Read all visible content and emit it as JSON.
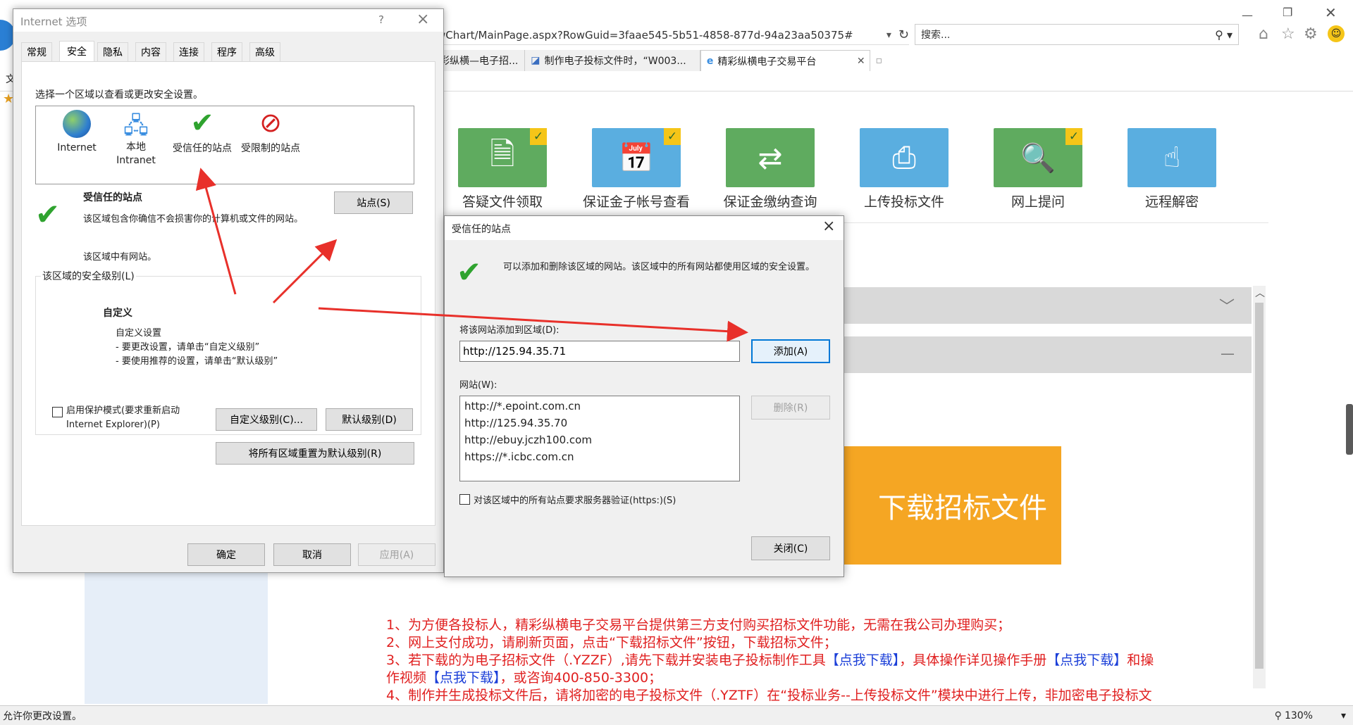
{
  "browser": {
    "address": "wChart/MainPage.aspx?RowGuid=3faae545-5b51-4858-877d-94a23aa50375#",
    "search_placeholder": "搜索...",
    "tabs": [
      {
        "label": "彩纵横—电子招..."
      },
      {
        "label": "制作电子投标文件时，“W003..."
      },
      {
        "label": "精彩纵横电子交易平台"
      }
    ],
    "zoom": "130%",
    "status": "允许你更改设置。",
    "left_edge": "文"
  },
  "page": {
    "tiles": [
      {
        "label": "答疑文件领取",
        "color": "#5fab5f",
        "checked": true
      },
      {
        "label": "保证金子帐号查看",
        "color": "#5aaee0",
        "checked": true
      },
      {
        "label": "保证金缴纳查询",
        "color": "#5fab5f",
        "checked": false
      },
      {
        "label": "上传投标文件",
        "color": "#5aaee0",
        "checked": false
      },
      {
        "label": "网上提问",
        "color": "#5fab5f",
        "checked": true
      },
      {
        "label": "远程解密",
        "color": "#5aaee0",
        "checked": false
      }
    ],
    "download_button": "下载招标文件",
    "notices": {
      "l1": "1、为方便各投标人，精彩纵横电子交易平台提供第三方支付购买招标文件功能，无需在我公司办理购买；",
      "l2": "2、网上支付成功，请刷新页面，点击“下载招标文件”按钮，下载招标文件；",
      "l3a": "3、若下载的为电子招标文件（.YZZF）,请先下载并安装电子投标制作工具",
      "l3b": "【点我下载】",
      "l3c": "，具体操作详见操作手册",
      "l3d": "【点我下载】",
      "l3e": "和操",
      "l4a": "作视频",
      "l4b": "【点我下载】",
      "l4c": "，或咨询400-850-3300；",
      "l5": "4、制作并生成投标文件后，请将加密的电子投标文件（.YZTF）在“投标业务--上传投标文件”模块中进行上传，非加密电子投标文"
    }
  },
  "internet_options": {
    "title": "Internet 选项",
    "help": "?",
    "close": "×",
    "tabs": [
      "常规",
      "安全",
      "隐私",
      "内容",
      "连接",
      "程序",
      "高级"
    ],
    "prompt": "选择一个区域以查看或更改安全设置。",
    "zones": [
      {
        "label": "Internet"
      },
      {
        "label": "本地\nIntranet"
      },
      {
        "label": "受信任的站点"
      },
      {
        "label": "受限制的站点"
      }
    ],
    "zone_title": "受信任的站点",
    "zone_desc": "该区域包含你确信不会损害你的计算机或文件的网站。",
    "zone_has_sites": "该区域中有网站。",
    "sites_button": "站点(S)",
    "level_group": "该区域的安全级别(L)",
    "level_name": "自定义",
    "level_desc1": "自定义设置",
    "level_desc2": "- 要更改设置，请单击“自定义级别”",
    "level_desc3": "- 要使用推荐的设置，请单击“默认级别”",
    "protected_mode": "启用保护模式(要求重新启动 Internet Explorer)(P)",
    "custom_level": "自定义级别(C)...",
    "default_level": "默认级别(D)",
    "reset_all": "将所有区域重置为默认级别(R)",
    "ok": "确定",
    "cancel": "取消",
    "apply": "应用(A)"
  },
  "trusted_sites": {
    "title": "受信任的站点",
    "close": "×",
    "desc": "可以添加和删除该区域的网站。该区域中的所有网站都使用区域的安全设置。",
    "add_label": "将该网站添加到区域(D):",
    "add_value": "http://125.94.35.71",
    "add_button": "添加(A)",
    "sites_label": "网站(W):",
    "sites": [
      "http://*.epoint.com.cn",
      "http://125.94.35.70",
      "http://ebuy.jczh100.com",
      "https://*.icbc.com.cn"
    ],
    "remove_button": "删除(R)",
    "https_check": "对该区域中的所有站点要求服务器验证(https:)(S)",
    "close_button": "关闭(C)"
  },
  "colors": {
    "accent": "#0078d7",
    "download": "#f5a623",
    "notice": "#e02020",
    "arrow": "#e8302a"
  }
}
